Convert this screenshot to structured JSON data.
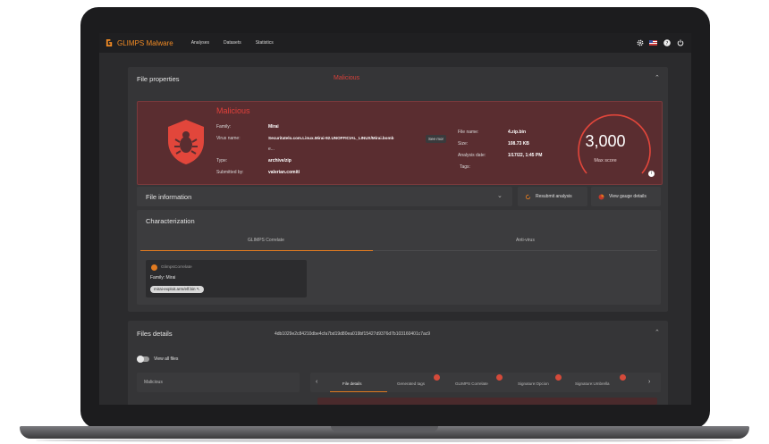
{
  "app": {
    "name": "GLIMPS Malware",
    "brand_color": "#f08a24"
  },
  "nav": [
    {
      "label": "Analyses"
    },
    {
      "label": "Datasets"
    },
    {
      "label": "Statistics"
    }
  ],
  "top_icons": [
    "gear-icon",
    "flag-icon",
    "help-icon",
    "power-icon"
  ],
  "file_properties": {
    "title": "File properties",
    "verdict": "Malicious",
    "card": {
      "verdict": "Malicious",
      "family_label": "Family:",
      "family": "Mirai",
      "virus_label": "Virus name:",
      "virus": "Securitatelo.com.Linux.Mirai-92.UNOFFICIAL_LINUX/Mirai.bomb",
      "see_more": "See mor",
      "ellipsis": "e...",
      "type_label": "Type:",
      "type": "archive/zip",
      "submitted_label": "Submitted by:",
      "submitted": "valerian.comiti",
      "filename_label": "File name:",
      "filename": "4.zip.bin",
      "size_label": "Size:",
      "size": "108.73 KB",
      "date_label": "Analysis date:",
      "date": "1/17/22, 1:45 PM",
      "tags_label": "Tags:",
      "score": "3,000",
      "score_label": "Max score"
    }
  },
  "file_information": {
    "title": "File information",
    "buttons": {
      "reanalysis": "Resubmit analysis",
      "gauge": "View gauge details"
    }
  },
  "characterization": {
    "title": "Characterization",
    "tabs": [
      "GLIMPS Correlate",
      "Anti-virus"
    ],
    "card": {
      "engine": "GlimpsCorrelate",
      "family": "Family: Mirai",
      "chip": "mirai-exploit.arm/elf.bin"
    }
  },
  "files_details": {
    "title": "Files details",
    "hash": "4db1029e2c84210dbe4cfa7bd19d80ea019bf15427d9376d7b103160401c7ac9",
    "view_all": "View all files",
    "malicious_label": "Malicious",
    "tabs": [
      "File details",
      "Generated tags",
      "GLIMPS Correlate",
      "Signature:Opcion",
      "Signature:Umbrella"
    ]
  }
}
